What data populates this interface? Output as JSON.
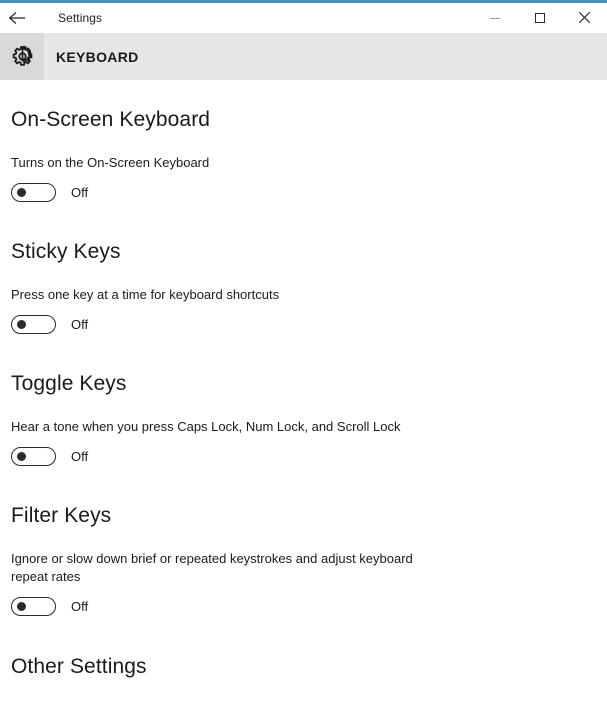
{
  "window": {
    "accent_color": "#4a8db7",
    "titlebar": {
      "back_label": "Back",
      "back_icon": "arrow-left-icon",
      "title": "Settings",
      "minimize_label": "Minimize",
      "maximize_label": "Maximize",
      "close_label": "Close"
    }
  },
  "header": {
    "icon": "gear-icon",
    "title": "KEYBOARD",
    "band_color": "#e6e6e6",
    "icon_box_color": "#d9d9d9"
  },
  "sections": [
    {
      "heading": "On-Screen Keyboard",
      "description": "Turns on the On-Screen Keyboard",
      "toggle": {
        "state": "Off",
        "checked": false
      }
    },
    {
      "heading": "Sticky Keys",
      "description": "Press one key at a time for keyboard shortcuts",
      "toggle": {
        "state": "Off",
        "checked": false
      }
    },
    {
      "heading": "Toggle Keys",
      "description": "Hear a tone when you press Caps Lock, Num Lock, and Scroll Lock",
      "toggle": {
        "state": "Off",
        "checked": false
      }
    },
    {
      "heading": "Filter Keys",
      "description": "Ignore or slow down brief or repeated keystrokes and adjust keyboard repeat rates",
      "toggle": {
        "state": "Off",
        "checked": false
      }
    },
    {
      "heading": "Other Settings"
    }
  ]
}
